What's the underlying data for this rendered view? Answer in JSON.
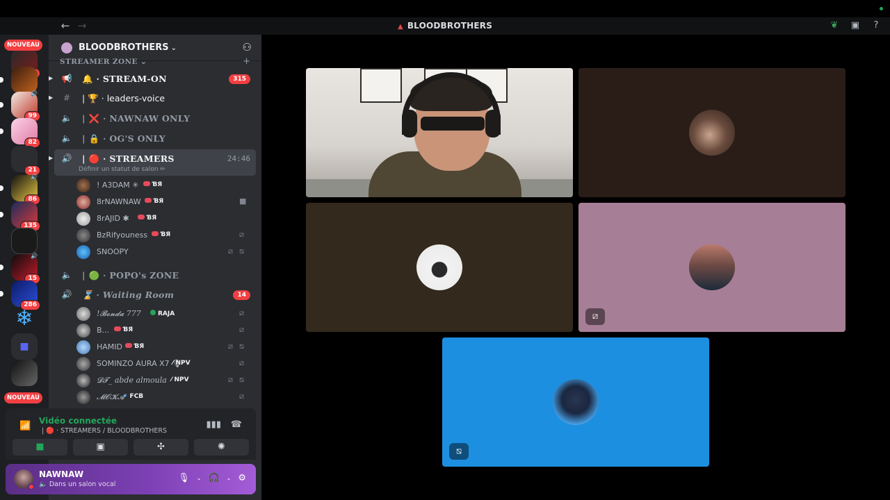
{
  "window": {
    "title": "BLOODBROTHERS",
    "back_glyph": "←",
    "forward_glyph": "→",
    "icons": [
      "nitro-leaf-icon",
      "inbox-icon",
      "help-icon"
    ]
  },
  "rail": {
    "nouveau_label_top": "NOUVEAU",
    "nouveau_label_bottom": "NOUVEAU",
    "servers": [
      {
        "name": "server-1",
        "count": "359"
      },
      {
        "name": "server-gamba",
        "count": ""
      },
      {
        "name": "server-3",
        "count": "99"
      },
      {
        "name": "server-4",
        "count": "82"
      },
      {
        "name": "server-5",
        "count": "21"
      },
      {
        "name": "server-6",
        "count": "86"
      },
      {
        "name": "server-7",
        "count": "135"
      },
      {
        "name": "server-8",
        "count": ""
      },
      {
        "name": "server-9",
        "count": "15"
      },
      {
        "name": "server-10",
        "count": "286"
      },
      {
        "name": "server-snowflake",
        "count": ""
      },
      {
        "name": "folder",
        "count": ""
      },
      {
        "name": "server-13",
        "count": ""
      }
    ]
  },
  "guild": {
    "name": "BLOODBROTHERS",
    "caret": "⌄",
    "category": "STREAMER ZONE ⌄",
    "category_plus": "+"
  },
  "channels": [
    {
      "prefix": "🔔 ·",
      "name": "STREAM-ON",
      "badge": "315"
    },
    {
      "prefix": "| 🏆 ·",
      "name": "leaders-voice"
    },
    {
      "prefix": "| ❌ ·",
      "name": "NAWNAW ONLY"
    },
    {
      "prefix": "| 🔒 ·",
      "name": "OG'S ONLY"
    },
    {
      "prefix": "| 🔴 ·",
      "name": "STREAMERS",
      "timer": "24:46",
      "status": "Définir un statut de salon ✏"
    },
    {
      "prefix": "| 🟢 ·",
      "name": "POPO's ZONE"
    },
    {
      "prefix": "⌛ ·",
      "name": "Waiting Room",
      "badge": "14"
    }
  ],
  "members_streamers": [
    {
      "name": "! A3DAM ✳",
      "tag": "ƁЯ"
    },
    {
      "name": "8rNAWNAW",
      "tag": "ƁЯ"
    },
    {
      "name": "8rAJID ✱",
      "tag": "ƁЯ"
    },
    {
      "name": "BzRifyouness",
      "tag": "ƁЯ"
    },
    {
      "name": "SNOOPY",
      "tag": ""
    }
  ],
  "members_waiting": [
    {
      "name": "!𝓑𝓸𝓷𝓭𝓪 777",
      "tag": "RAJA"
    },
    {
      "name": "B...",
      "tag": "ƁЯ"
    },
    {
      "name": "HAMID",
      "tag": "ƁЯ"
    },
    {
      "name": "SOMINZO AURA X7 🎙",
      "tag": "NPV"
    },
    {
      "name": "𝓓𝓣_ abde almoula",
      "tag": "NPV"
    },
    {
      "name": "𝓜𝓞𝓚𝓐",
      "tag": "FCB"
    }
  ],
  "voice": {
    "connected": "Vidéo connectée",
    "location": "| 🔴 · STREAMERS / BLOODBROTHERS"
  },
  "user": {
    "name": "NAWNAW",
    "status": "Dans un salon vocal"
  },
  "colors": {
    "accent_green": "#23a55a",
    "badge_red": "#f23f42",
    "userbar_purple": "#7b3fb3"
  }
}
